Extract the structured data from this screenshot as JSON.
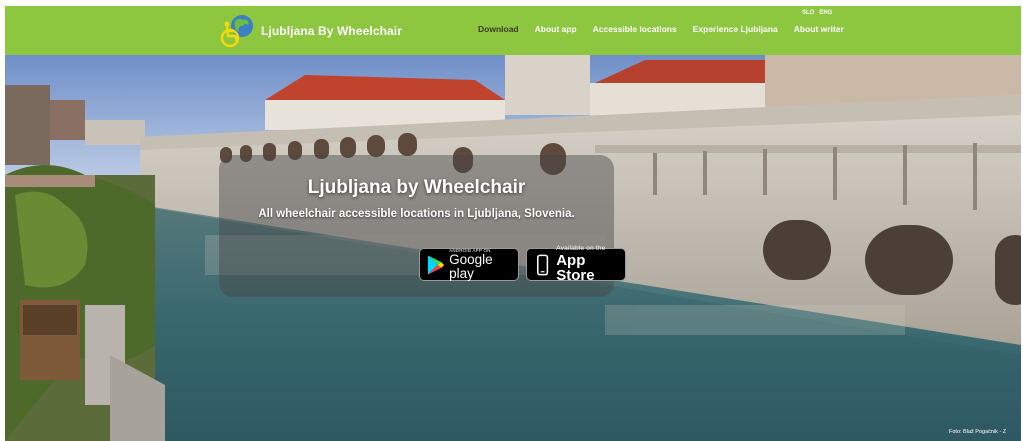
{
  "header": {
    "brand_name": "Ljubljana By Wheelchair",
    "nav": [
      {
        "label": "Download",
        "active": true
      },
      {
        "label": "About app",
        "active": false
      },
      {
        "label": "Accessible locations",
        "active": false
      },
      {
        "label": "Experience Ljubljana",
        "active": false
      },
      {
        "label": "About writer",
        "active": false
      }
    ],
    "languages": [
      "SLO",
      "ENG"
    ],
    "bar_color": "#8dc63f"
  },
  "hero": {
    "title": "Ljubljana by Wheelchair",
    "subtitle": "All wheelchair accessible locations in Ljubljana, Slovenia.",
    "google_play": {
      "small": "ANDROID APP ON",
      "big": "Google play"
    },
    "app_store": {
      "small": "Available on the",
      "big": "App Store"
    },
    "photo_credit": "Foto: Blaž Pogačnik - Z"
  },
  "icons": [
    "logo-globe-wheelchair",
    "google-play-icon",
    "apple-phone-icon"
  ]
}
